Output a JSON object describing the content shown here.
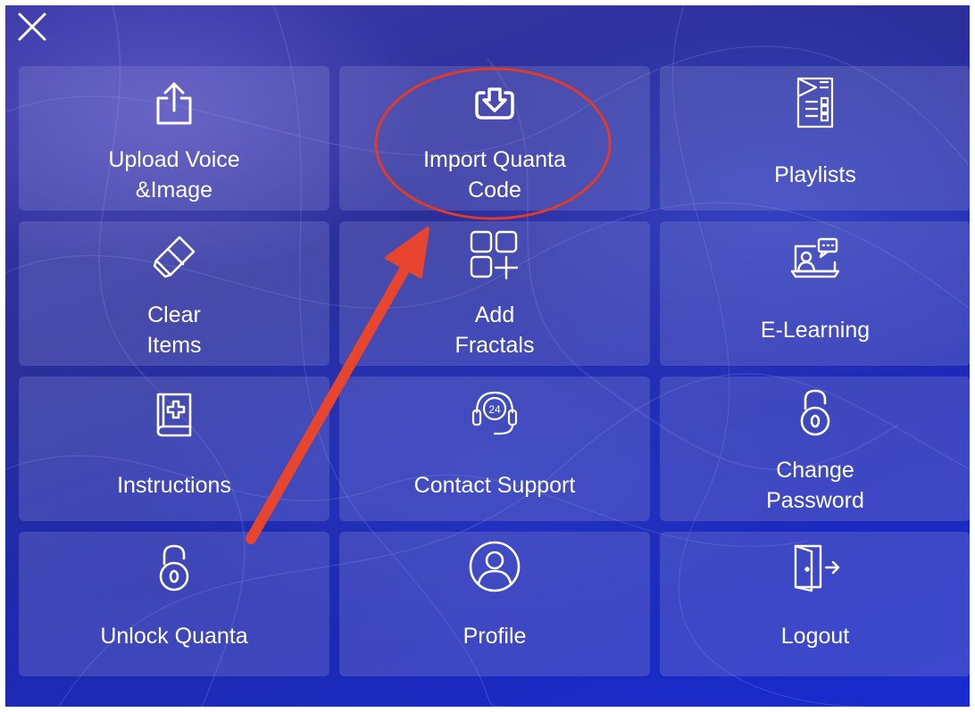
{
  "menu": {
    "close_icon": "close-icon",
    "items": [
      {
        "label": "Upload Voice\n&Image",
        "icon": "upload-icon"
      },
      {
        "label": "Import Quanta\nCode",
        "icon": "import-download-icon"
      },
      {
        "label": "Playlists",
        "icon": "playlist-icon"
      },
      {
        "label": "Clear\nItems",
        "icon": "eraser-icon"
      },
      {
        "label": "Add\nFractals",
        "icon": "add-grid-icon"
      },
      {
        "label": "E-Learning",
        "icon": "elearning-icon"
      },
      {
        "label": "Instructions",
        "icon": "book-medical-icon"
      },
      {
        "label": "Contact Support",
        "icon": "support-24-headset-icon"
      },
      {
        "label": "Change\nPassword",
        "icon": "padlock-icon"
      },
      {
        "label": "Unlock Quanta",
        "icon": "padlock-icon"
      },
      {
        "label": "Profile",
        "icon": "user-circle-icon"
      },
      {
        "label": "Logout",
        "icon": "door-exit-icon"
      }
    ]
  },
  "annotation": {
    "highlight_color": "#e03a2a",
    "highlight_target": "Import Quanta Code",
    "arrow_color": "#e8452f"
  },
  "colors": {
    "background_primary": "#2a2f9a",
    "background_secondary": "#1a2bd0",
    "tile_fill": "rgba(140,140,210,0.30)",
    "text": "#ffffff"
  }
}
